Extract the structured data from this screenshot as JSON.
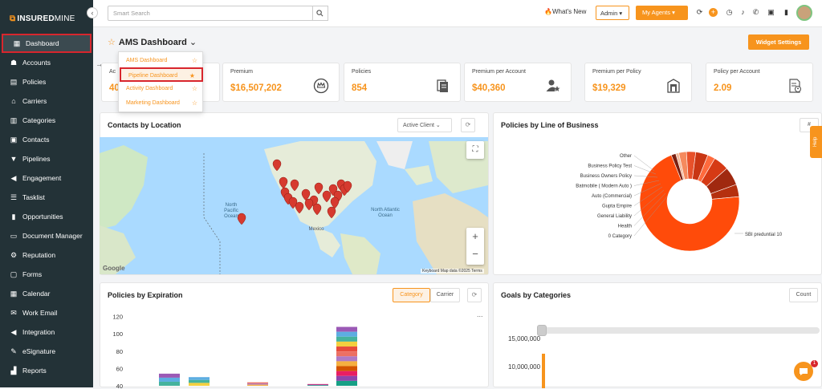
{
  "brand": {
    "name_bold": "INSURED",
    "name_light": "MINE"
  },
  "sidebar": {
    "items": [
      {
        "label": "Dashboard",
        "icon": "dashboard-icon"
      },
      {
        "label": "Accounts",
        "icon": "accounts-icon"
      },
      {
        "label": "Policies",
        "icon": "policies-icon"
      },
      {
        "label": "Carriers",
        "icon": "carriers-icon"
      },
      {
        "label": "Categories",
        "icon": "categories-icon"
      },
      {
        "label": "Contacts",
        "icon": "contacts-icon"
      },
      {
        "label": "Pipelines",
        "icon": "pipelines-icon"
      },
      {
        "label": "Engagement",
        "icon": "engagement-icon"
      },
      {
        "label": "Tasklist",
        "icon": "tasklist-icon"
      },
      {
        "label": "Opportunities",
        "icon": "opportunities-icon"
      },
      {
        "label": "Document Manager",
        "icon": "folder-icon"
      },
      {
        "label": "Reputation",
        "icon": "reputation-icon"
      },
      {
        "label": "Forms",
        "icon": "forms-icon"
      },
      {
        "label": "Calendar",
        "icon": "calendar-icon"
      },
      {
        "label": "Work Email",
        "icon": "email-icon"
      },
      {
        "label": "Integration",
        "icon": "integration-icon"
      },
      {
        "label": "eSignature",
        "icon": "signature-icon"
      },
      {
        "label": "Reports",
        "icon": "reports-icon"
      }
    ]
  },
  "topbar": {
    "search_placeholder": "Smart Search",
    "whats_new": "What's New",
    "role": "Admin",
    "agents": "My Agents"
  },
  "dashboard": {
    "title": "AMS Dashboard",
    "widget_settings": "Widget Settings",
    "menu": [
      {
        "label": "AMS Dashboard"
      },
      {
        "label": "Pipeline Dashboard"
      },
      {
        "label": "Activity Dashboard"
      },
      {
        "label": "Marketing Dashboard"
      }
    ]
  },
  "kpis": [
    {
      "label": "Ac",
      "value": "40"
    },
    {
      "label": "Premium",
      "value": "$16,507,202"
    },
    {
      "label": "Policies",
      "value": "854"
    },
    {
      "label": "Premium per Account",
      "value": "$40,360"
    },
    {
      "label": "Premium per Policy",
      "value": "$19,329"
    },
    {
      "label": "Policy per Account",
      "value": "2.09"
    }
  ],
  "contacts_panel": {
    "title": "Contacts by Location",
    "filter": "Active Client",
    "map_labels": {
      "pacific": "North Pacific Ocean",
      "atlantic": "North Atlantic Ocean",
      "mexico": "Mexico"
    },
    "attribution": "Keyboard  Map data ©2025  Terms",
    "google": "Google"
  },
  "lob_panel": {
    "title": "Policies by Line of Business",
    "hash": "#"
  },
  "expiration_panel": {
    "title": "Policies by Expiration",
    "tab_category": "Category",
    "tab_carrier": "Carrier",
    "more": "..."
  },
  "goals_panel": {
    "title": "Goals by Categories",
    "count": "Count"
  },
  "help": "Help",
  "chat_badge": "1",
  "chart_data": [
    {
      "type": "pie",
      "title": "Policies by Line of Business",
      "labels": [
        "Other",
        "Business Policy Test",
        "Business Owners Policy",
        "Batmobile ( Modern Auto )",
        "Auto (Commercial)",
        "Gupta Empire",
        "General Liability",
        "Health",
        "0 Category",
        "SBI preduntial 10"
      ],
      "values": [
        1.5,
        1,
        2.5,
        3,
        4,
        2.5,
        5,
        6,
        4,
        70.5
      ],
      "colors": [
        "#7a1f10",
        "#f2b89a",
        "#f58a5e",
        "#e8512a",
        "#c93613",
        "#ff6a3d",
        "#d63a15",
        "#a02910",
        "#b5300f",
        "#ff4b0a"
      ],
      "hole": 0.45
    },
    {
      "type": "bar",
      "title": "Policies by Expiration",
      "ylim": [
        0,
        120
      ],
      "yticks": [
        40,
        60,
        80,
        100,
        120
      ],
      "stack_totals": [
        54,
        50,
        0,
        0,
        0,
        44,
        0,
        0,
        0,
        42,
        0,
        0,
        108
      ],
      "bar_colors": [
        "#9b59b6",
        "#5dade2",
        "#45b39d",
        "#f4d03f",
        "#e74c3c",
        "#ec7063",
        "#af7ac5",
        "#f5b041",
        "#d35400",
        "#e91e63",
        "#8e44ad",
        "#16a085"
      ]
    },
    {
      "type": "bar",
      "title": "Goals by Categories",
      "yticks": [
        "15,000,000",
        "10,000,000"
      ]
    }
  ]
}
